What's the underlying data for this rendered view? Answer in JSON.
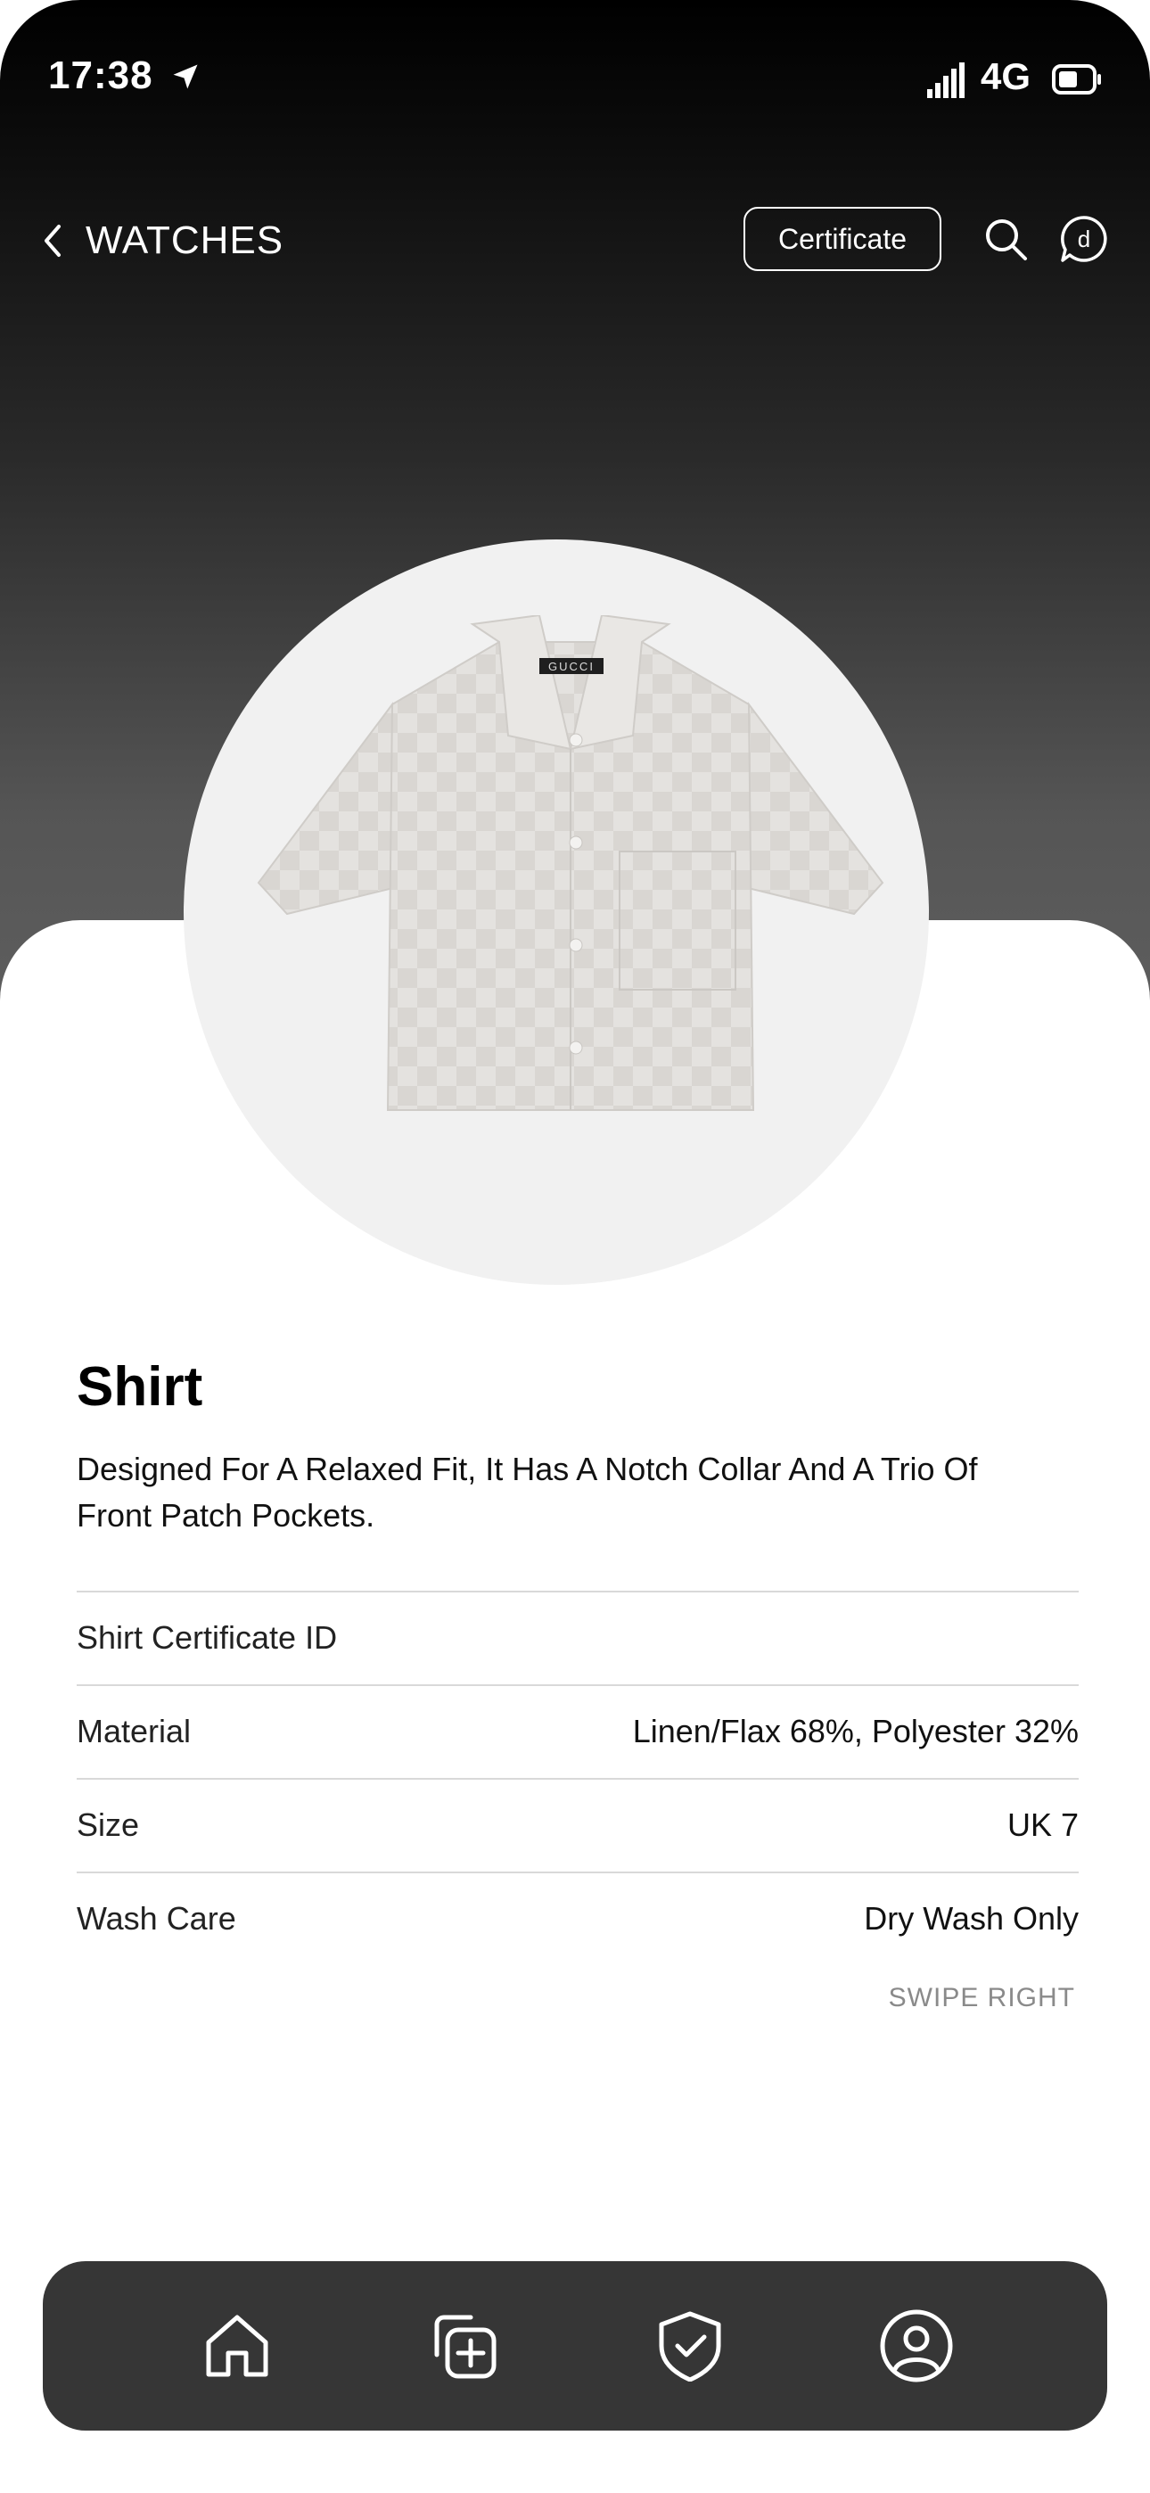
{
  "status_bar": {
    "time": "17:38",
    "network": "4G"
  },
  "header": {
    "back_label": "WATCHES",
    "certificate_label": "Certificate",
    "profile_letter": "d"
  },
  "product": {
    "brand_tag": "GUCCI",
    "title": "Shirt",
    "description": "Designed For A Relaxed Fit, It Has A Notch Collar And A Trio Of Front Patch Pockets.",
    "details": [
      {
        "label": "Shirt Certificate ID",
        "value": ""
      },
      {
        "label": "Material",
        "value": "Linen/Flax 68%,  Polyester 32%"
      },
      {
        "label": "Size",
        "value": "UK 7"
      },
      {
        "label": "Wash Care",
        "value": "Dry Wash Only"
      }
    ],
    "swipe_hint": "SWIPE RIGHT"
  },
  "tab_bar": {
    "items": [
      {
        "icon": "home-icon"
      },
      {
        "icon": "add-collection-icon"
      },
      {
        "icon": "shield-check-icon"
      },
      {
        "icon": "profile-icon"
      }
    ]
  },
  "colors": {
    "tab_bar_bg": "#363636",
    "circle_bg": "#f1f1f1",
    "hero_top": "#000000",
    "hero_bottom": "#5e5e5e"
  }
}
